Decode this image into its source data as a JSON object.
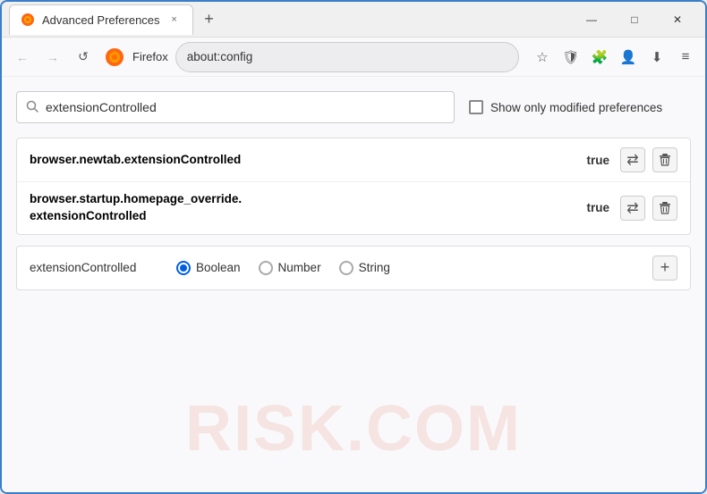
{
  "browser": {
    "tab_title": "Advanced Preferences",
    "tab_close": "×",
    "new_tab": "+",
    "url": "about:config",
    "browser_name": "Firefox",
    "win_minimize": "—",
    "win_maximize": "□",
    "win_close": "✕"
  },
  "nav": {
    "back_icon": "←",
    "forward_icon": "→",
    "refresh_icon": "↺",
    "bookmark_icon": "☆",
    "shield_icon": "🛡",
    "extension_icon": "🧩",
    "profile_icon": "👤",
    "downloads_icon": "⬇",
    "menu_icon": "≡"
  },
  "search": {
    "placeholder": "",
    "value": "extensionControlled",
    "show_modified_label": "Show only modified preferences"
  },
  "preferences": [
    {
      "name": "browser.newtab.extensionControlled",
      "value": "true"
    },
    {
      "name": "browser.startup.homepage_override.\nextensionControlled",
      "name_line1": "browser.startup.homepage_override.",
      "name_line2": "extensionControlled",
      "value": "true",
      "multiline": true
    }
  ],
  "add_preference": {
    "name": "extensionControlled",
    "types": [
      {
        "label": "Boolean",
        "selected": true
      },
      {
        "label": "Number",
        "selected": false
      },
      {
        "label": "String",
        "selected": false
      }
    ],
    "add_button": "+"
  },
  "watermark": "RISK.COM"
}
